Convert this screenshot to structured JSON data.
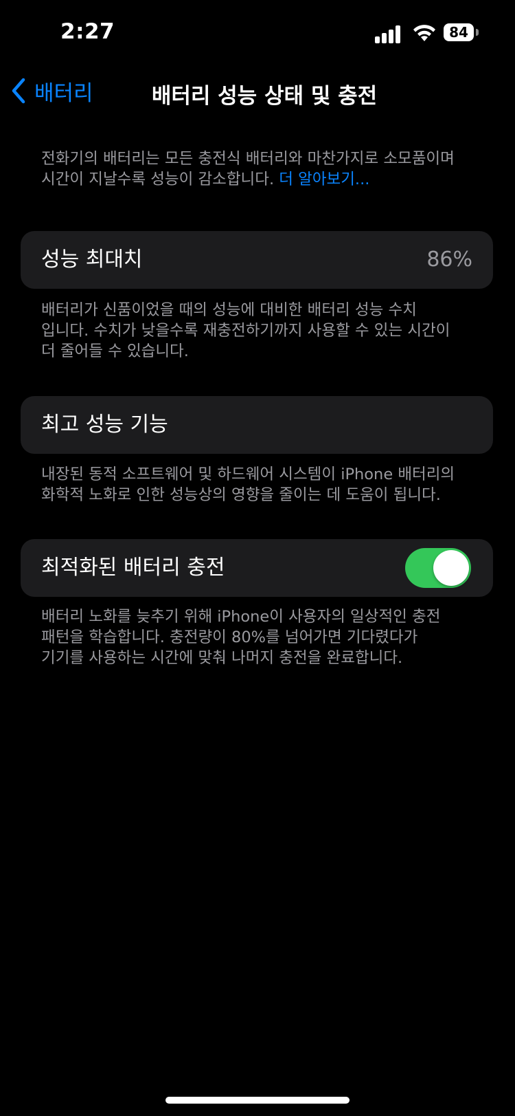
{
  "status_bar": {
    "time": "2:27",
    "battery_level": "84"
  },
  "nav": {
    "back_label": "배터리",
    "title": "배터리 성능 상태 및 충전"
  },
  "intro": {
    "text_line1": "전화기의 배터리는 모든 충전식 배터리와 마찬가지로 소모품이며",
    "text_line2": "시간이 지날수록 성능이 감소합니다. ",
    "link": "더 알아보기..."
  },
  "max_capacity": {
    "label": "성능 최대치",
    "value": "86%",
    "footer_line1": "배터리가 신품이었을 때의 성능에 대비한 배터리 성능 수치",
    "footer_line2": "입니다. 수치가 낮을수록 재충전하기까지 사용할 수 있는 시간이",
    "footer_line3": "더 줄어들 수 있습니다."
  },
  "peak_performance": {
    "label": "최고 성능 기능",
    "footer_line1": "내장된 동적 소프트웨어 및 하드웨어 시스템이 iPhone 배터리의",
    "footer_line2": "화학적 노화로 인한 성능상의 영향을 줄이는 데 도움이 됩니다."
  },
  "optimized_charging": {
    "label": "최적화된 배터리 충전",
    "enabled": true,
    "footer_line1": "배터리 노화를 늦추기 위해 iPhone이 사용자의 일상적인 충전",
    "footer_line2": "패턴을 학습합니다. 충전량이 80%를 넘어가면 기다렸다가",
    "footer_line3": "기기를 사용하는 시간에 맞춰 나머지 충전을 완료합니다."
  },
  "colors": {
    "accent": "#0a84ff",
    "toggle_on": "#34c759",
    "cell_bg": "#1c1c1e",
    "secondary_text": "#9a9a9f"
  }
}
